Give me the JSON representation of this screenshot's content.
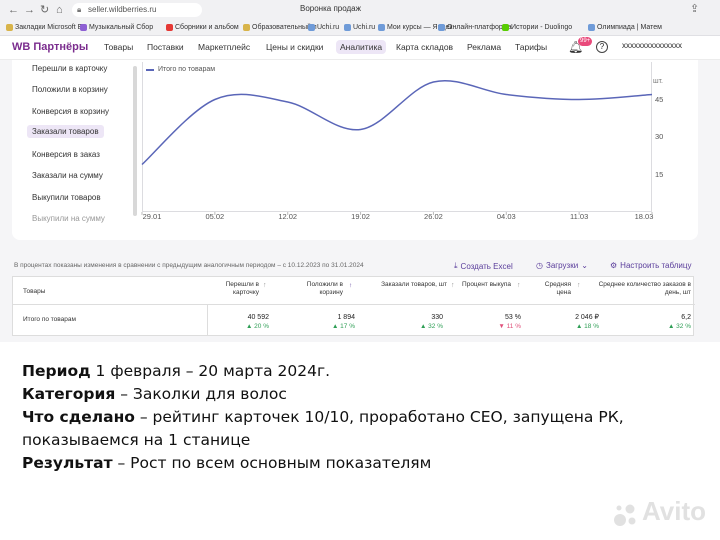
{
  "browser": {
    "url": "seller.wildberries.ru",
    "tab_title": "Воронка продаж",
    "bookmarks": [
      {
        "label": "Закладки Microsoft Е",
        "icon": "folder-icon"
      },
      {
        "label": "Музыкальный Сбор",
        "icon": "music-icon"
      },
      {
        "label": "Сборники и альбом",
        "icon": "youtube-icon"
      },
      {
        "label": "Образовательный п",
        "icon": "folder-icon"
      },
      {
        "label": "Uchi.ru",
        "icon": "site-icon"
      },
      {
        "label": "Uchi.ru",
        "icon": "site-icon"
      },
      {
        "label": "Мои курсы — Яндек",
        "icon": "site-icon"
      },
      {
        "label": "Онлайн-платформа",
        "icon": "site-icon"
      },
      {
        "label": "Истории - Duolingo",
        "icon": "duolingo-icon"
      },
      {
        "label": "Олимпиада | Матем",
        "icon": "site-icon"
      }
    ]
  },
  "header": {
    "logo": "WB Партнёры",
    "menu": [
      "Товары",
      "Поставки",
      "Маркетплейс",
      "Цены и скидки",
      "Аналитика",
      "Карта складов",
      "Реклама",
      "Тарифы"
    ],
    "active_menu": "Аналитика",
    "notifications_badge": "99+",
    "user_name": "xxxxxxxxxxxxxxx"
  },
  "metrics": [
    "Перешли в карточку",
    "Положили в корзину",
    "Конверсия в корзину",
    "Заказали товаров",
    "Конверсия в заказ",
    "Заказали на сумму",
    "Выкупили товаров",
    "Выкупили на сумму"
  ],
  "active_metric": "Заказали товаров",
  "chart_data": {
    "type": "line",
    "x": [
      "29.01",
      "05.02",
      "12.02",
      "19.02",
      "26.02",
      "04.03",
      "11.03",
      "18.03"
    ],
    "series": [
      {
        "name": "Итого по товарам",
        "values": [
          19,
          45,
          44,
          33,
          52,
          47,
          45,
          47
        ]
      }
    ],
    "ylabel": "шт.",
    "yticks": [
      15,
      30,
      45
    ],
    "ylim": [
      0,
      60
    ],
    "grid": false,
    "legend": "top-left",
    "color": "#5a66b8"
  },
  "table": {
    "period_note": "В процентах показаны изменения в сравнении с предыдущим аналогичным периодом – с 10.12.2023 по 31.01.2024",
    "actions": [
      "Создать Excel",
      "Загрузки",
      "Настроить таблицу"
    ],
    "columns": [
      "Товары",
      "Перешли в карточку",
      "Положили в корзину",
      "Заказали товаров, шт",
      "Процент выкупа",
      "Средняя цена",
      "Среднее количество заказов в день, шт"
    ],
    "total_row": {
      "label": "Итого по товарам",
      "cells": [
        {
          "value": "40 592",
          "change": "▲ 20 %",
          "dir": "up"
        },
        {
          "value": "1 894",
          "change": "▲ 17 %",
          "dir": "up"
        },
        {
          "value": "330",
          "change": "▲ 32 %",
          "dir": "up"
        },
        {
          "value": "53 %",
          "change": "▼ 11 %",
          "dir": "down"
        },
        {
          "value": "2 046 ₽",
          "change": "▲ 18 %",
          "dir": "up"
        },
        {
          "value": "6,2",
          "change": "▲ 32 %",
          "dir": "up"
        }
      ]
    }
  },
  "caption": {
    "period_label": "Период",
    "period_text": " 1 февраля – 20 марта 2024г.",
    "category_label": "Категория",
    "category_text": " – Заколки для волос",
    "done_label": "Что сделано",
    "done_text": " – рейтинг карточек 10/10, проработано СЕО, запущена РК, показываемся на 1 станице",
    "result_label": "Результат",
    "result_text": " – Рост по всем основным показателям"
  },
  "watermark": "Avito"
}
